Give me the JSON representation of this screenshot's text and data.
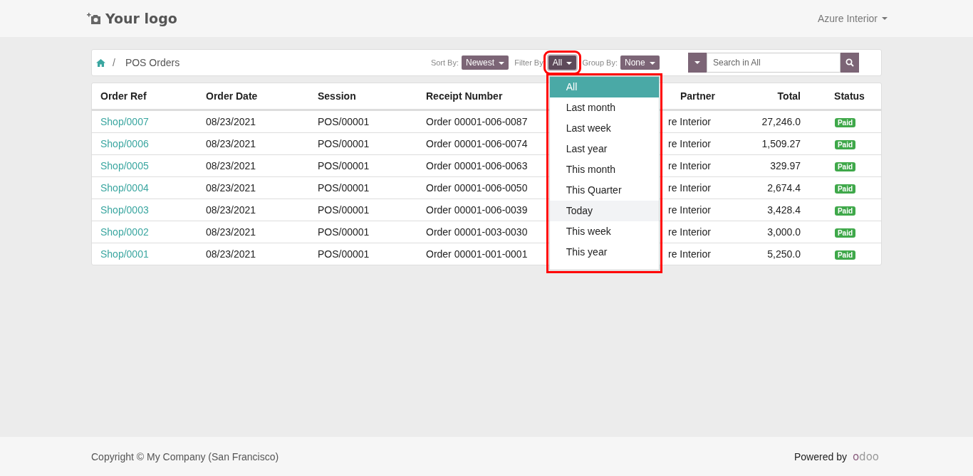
{
  "header": {
    "logo": "Your logo",
    "user_menu": "Azure Interior"
  },
  "breadcrumb": {
    "separator": "/",
    "current": "POS Orders"
  },
  "controls": [
    {
      "label": "Sort By:",
      "value": "Newest",
      "open": false
    },
    {
      "label": "Filter By:",
      "value": "All",
      "open": true
    },
    {
      "label": "Group By:",
      "value": "None",
      "open": false
    }
  ],
  "search": {
    "placeholder": "Search in All"
  },
  "filter_menu": [
    {
      "label": "All",
      "selected": true,
      "hovered": false
    },
    {
      "label": "Last month",
      "selected": false,
      "hovered": false
    },
    {
      "label": "Last week",
      "selected": false,
      "hovered": false
    },
    {
      "label": "Last year",
      "selected": false,
      "hovered": false
    },
    {
      "label": "This month",
      "selected": false,
      "hovered": false
    },
    {
      "label": "This Quarter",
      "selected": false,
      "hovered": false
    },
    {
      "label": "Today",
      "selected": false,
      "hovered": true
    },
    {
      "label": "This week",
      "selected": false,
      "hovered": false
    },
    {
      "label": "This year",
      "selected": false,
      "hovered": false
    }
  ],
  "table": {
    "columns": [
      "Order Ref",
      "Order Date",
      "Session",
      "Receipt Number",
      "Partner",
      "Total",
      "Status"
    ],
    "rows": [
      {
        "ref": "Shop/0007",
        "date": "08/23/2021",
        "session": "POS/00001",
        "receipt": "Order 00001-006-0087",
        "partner": "re Interior",
        "total": "27,246.0",
        "status": "Paid"
      },
      {
        "ref": "Shop/0006",
        "date": "08/23/2021",
        "session": "POS/00001",
        "receipt": "Order 00001-006-0074",
        "partner": "re Interior",
        "total": "1,509.27",
        "status": "Paid"
      },
      {
        "ref": "Shop/0005",
        "date": "08/23/2021",
        "session": "POS/00001",
        "receipt": "Order 00001-006-0063",
        "partner": "re Interior",
        "total": "329.97",
        "status": "Paid"
      },
      {
        "ref": "Shop/0004",
        "date": "08/23/2021",
        "session": "POS/00001",
        "receipt": "Order 00001-006-0050",
        "partner": "re Interior",
        "total": "2,674.4",
        "status": "Paid"
      },
      {
        "ref": "Shop/0003",
        "date": "08/23/2021",
        "session": "POS/00001",
        "receipt": "Order 00001-006-0039",
        "partner": "re Interior",
        "total": "3,428.4",
        "status": "Paid"
      },
      {
        "ref": "Shop/0002",
        "date": "08/23/2021",
        "session": "POS/00001",
        "receipt": "Order 00001-003-0030",
        "partner": "re Interior",
        "total": "3,000.0",
        "status": "Paid"
      },
      {
        "ref": "Shop/0001",
        "date": "08/23/2021",
        "session": "POS/00001",
        "receipt": "Order 00001-001-0001",
        "partner": "re Interior",
        "total": "5,250.0",
        "status": "Paid"
      }
    ]
  },
  "footer": {
    "copyright": "Copyright © My Company (San Francisco)",
    "powered_by": "Powered by",
    "brand_first": "o",
    "brand_rest": "doo"
  }
}
